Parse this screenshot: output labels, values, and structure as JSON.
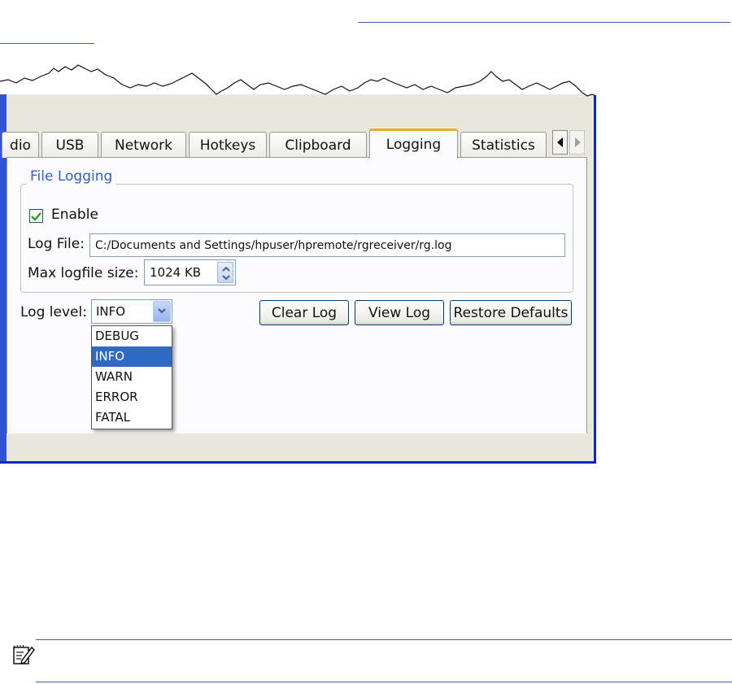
{
  "tabs": {
    "items": [
      {
        "label": "dio"
      },
      {
        "label": "USB"
      },
      {
        "label": "Network"
      },
      {
        "label": "Hotkeys"
      },
      {
        "label": "Clipboard"
      },
      {
        "label": "Logging"
      },
      {
        "label": "Statistics"
      }
    ],
    "active": "Logging"
  },
  "file_logging": {
    "group_title": "File Logging",
    "enable_label": "Enable",
    "enable_checked": true,
    "log_file_label": "Log File:",
    "log_file_value": "C:/Documents and Settings/hpuser/hpremote/rgreceiver/rg.log",
    "max_size_label": "Max logfile size:",
    "max_size_value": "1024 KB"
  },
  "log_level": {
    "label": "Log level:",
    "selected": "INFO",
    "options": [
      "DEBUG",
      "INFO",
      "WARN",
      "ERROR",
      "FATAL"
    ]
  },
  "buttons": {
    "clear_log": "Clear Log",
    "view_log": "View Log",
    "restore_defaults": "Restore Defaults"
  },
  "colors": {
    "accent_tab": "#f0a830",
    "selection": "#316ac5",
    "group_title": "#2f5fc8",
    "window_border": "#0a28c8"
  }
}
